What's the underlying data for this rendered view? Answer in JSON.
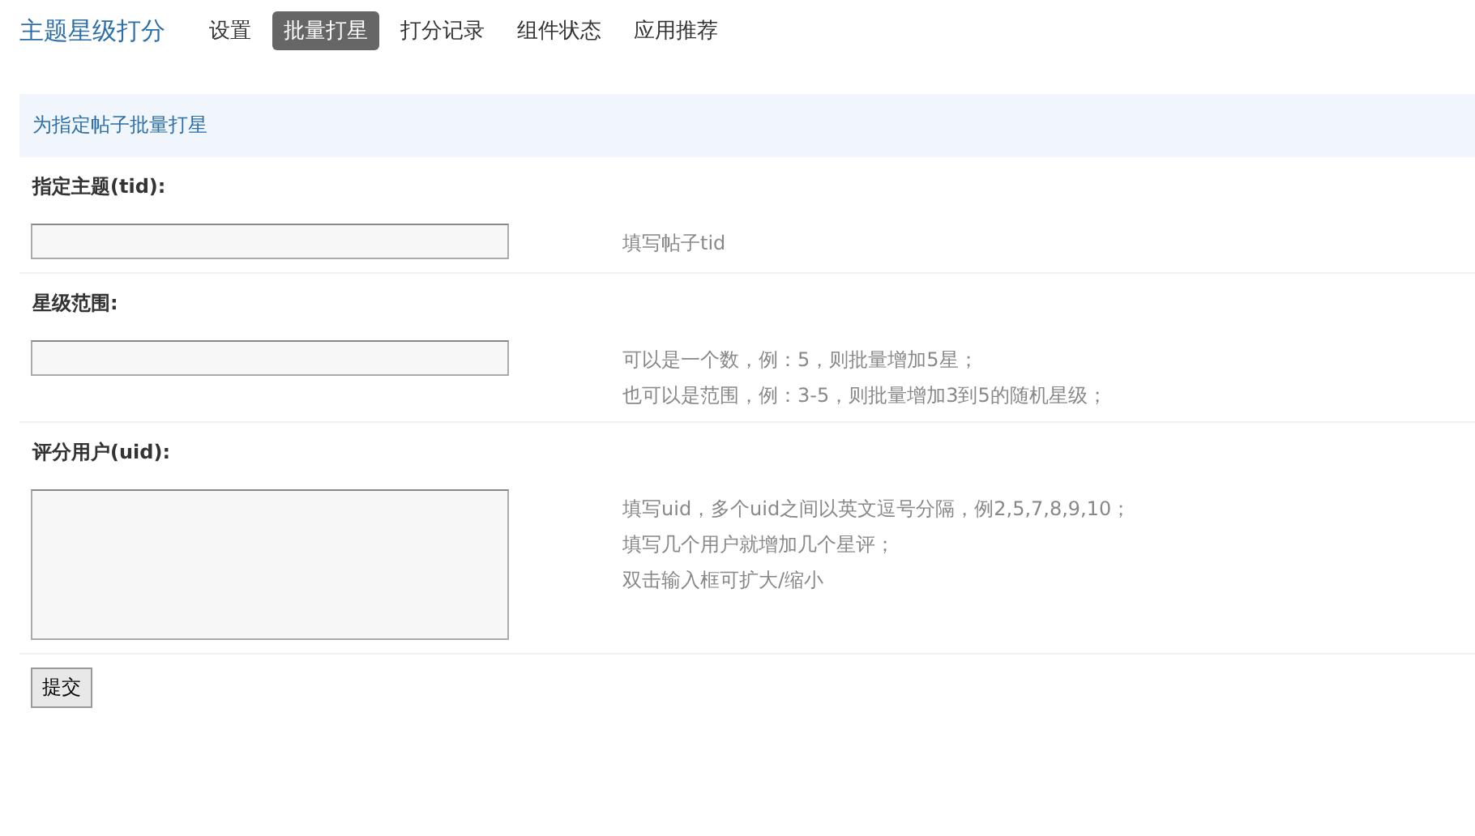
{
  "header": {
    "title": "主题星级打分",
    "tabs": [
      {
        "label": "设置",
        "selected": false
      },
      {
        "label": "批量打星",
        "selected": true
      },
      {
        "label": "打分记录",
        "selected": false
      },
      {
        "label": "组件状态",
        "selected": false
      },
      {
        "label": "应用推荐",
        "selected": false
      }
    ]
  },
  "section": {
    "title": "为指定帖子批量打星"
  },
  "fields": [
    {
      "label": "指定主题(tid):",
      "kind": "input",
      "hints": [
        "填写帖子tid"
      ]
    },
    {
      "label": "星级范围:",
      "kind": "input",
      "hints": [
        "可以是一个数，例：5，则批量增加5星；",
        "也可以是范围，例：3-5，则批量增加3到5的随机星级；"
      ]
    },
    {
      "label": "评分用户(uid):",
      "kind": "textarea",
      "hints": [
        "填写uid，多个uid之间以英文逗号分隔，例2,5,7,8,9,10；",
        "填写几个用户就增加几个星评；",
        "双击输入框可扩大/缩小"
      ]
    }
  ],
  "submit": "提交"
}
